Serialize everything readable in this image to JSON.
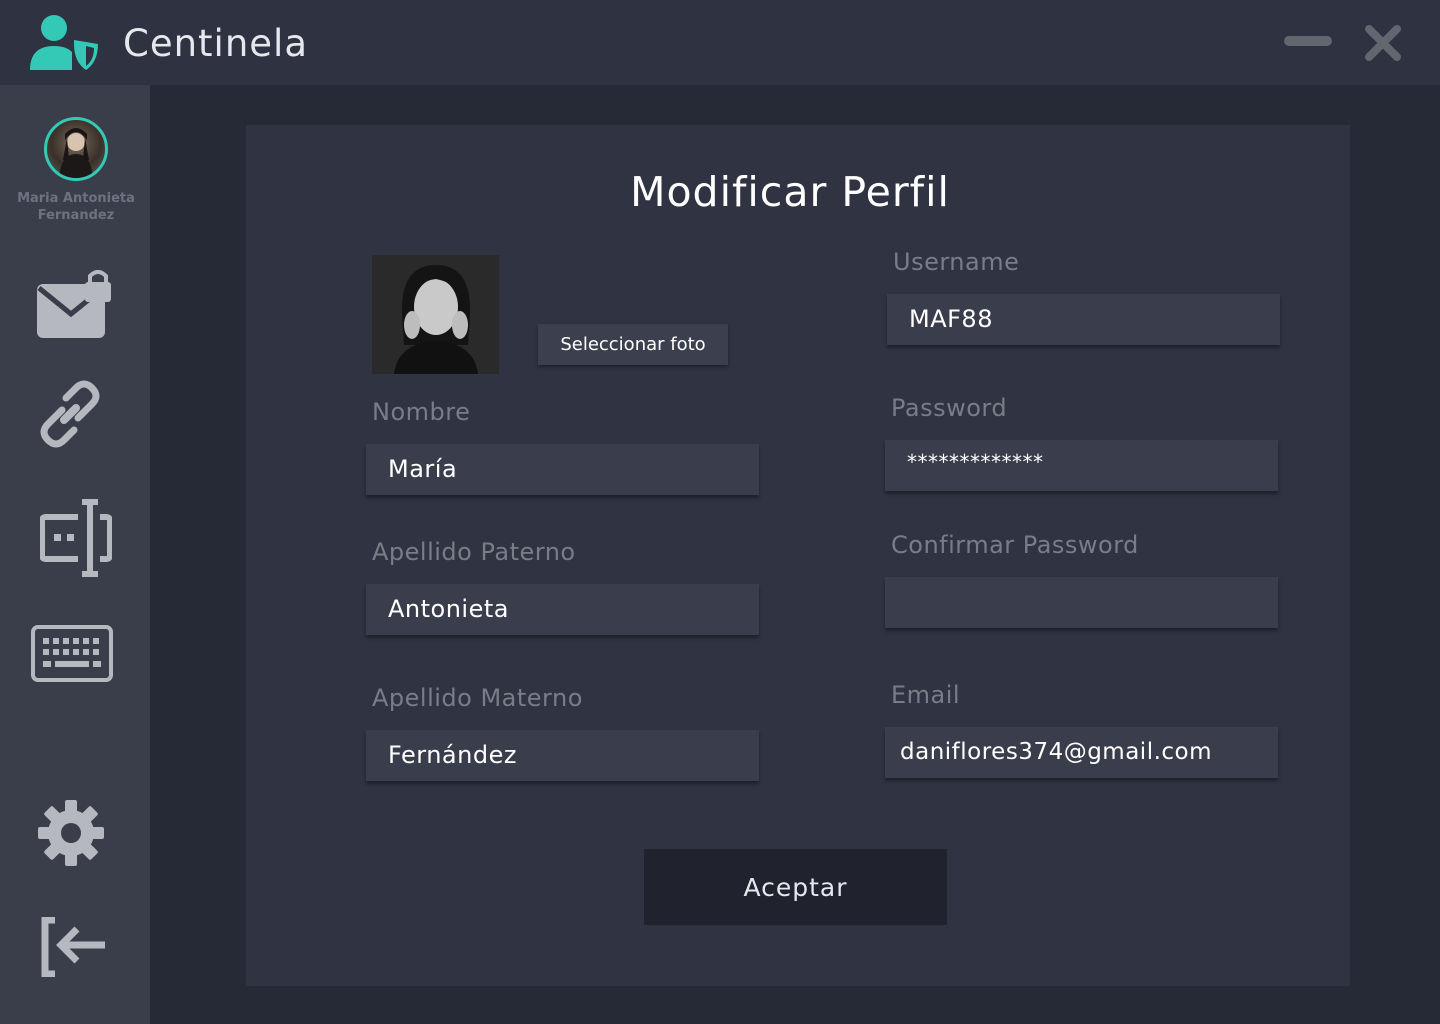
{
  "app": {
    "title": "Centinela",
    "icons": {
      "logo": "user-shield-icon",
      "minimize": "minimize-icon",
      "close": "close-icon"
    },
    "accent_color": "#34c8b6"
  },
  "sidebar": {
    "user_name": "Maria Antonieta Fernandez",
    "items": [
      {
        "icon": "secure-mail-icon"
      },
      {
        "icon": "link-icon"
      },
      {
        "icon": "text-input-icon"
      },
      {
        "icon": "keyboard-icon"
      },
      {
        "icon": "settings-gear-icon"
      },
      {
        "icon": "logout-icon"
      }
    ]
  },
  "form": {
    "title": "Modificar Perfil",
    "select_photo_label": "Seleccionar foto",
    "fields": {
      "nombre": {
        "label": "Nombre",
        "value": "María"
      },
      "apellido_paterno": {
        "label": "Apellido Paterno",
        "value": "Antonieta"
      },
      "apellido_materno": {
        "label": "Apellido Materno",
        "value": "Fernández"
      },
      "username": {
        "label": "Username",
        "value": "MAF88"
      },
      "password": {
        "label": "Password",
        "value": "*************"
      },
      "confirm_password": {
        "label": "Confirmar Password",
        "value": ""
      },
      "email": {
        "label": "Email",
        "value": "daniflores374@gmail.com"
      }
    },
    "accept_label": "Aceptar"
  }
}
